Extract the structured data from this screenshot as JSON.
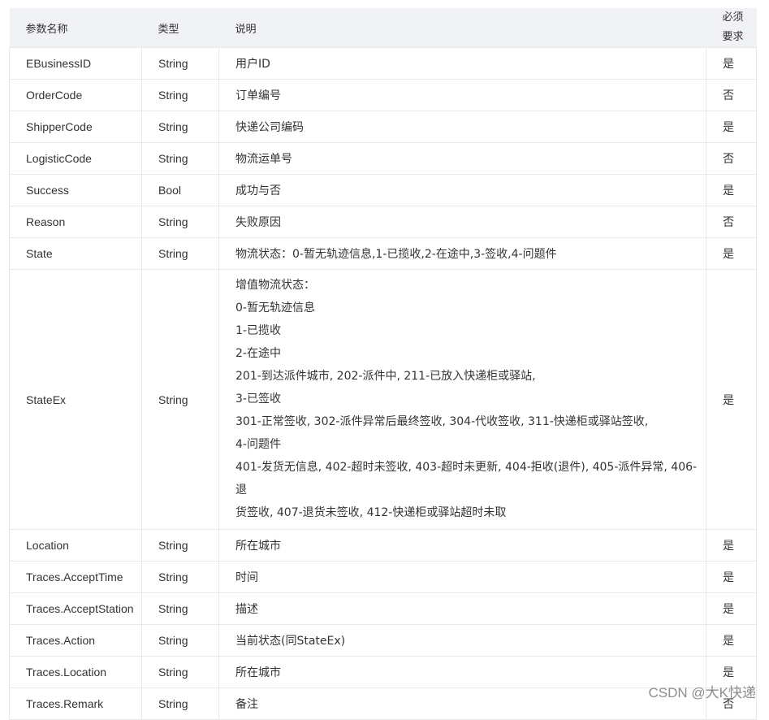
{
  "header": {
    "name": "参数名称",
    "type": "类型",
    "desc": "说明",
    "required_line1": "必须",
    "required_line2": "要求"
  },
  "rows": [
    {
      "name": "EBusinessID",
      "type": "String",
      "desc": [
        "用户ID"
      ],
      "required": "是"
    },
    {
      "name": "OrderCode",
      "type": "String",
      "desc": [
        "订单编号"
      ],
      "required": "否"
    },
    {
      "name": "ShipperCode",
      "type": "String",
      "desc": [
        "快递公司编码"
      ],
      "required": "是"
    },
    {
      "name": "LogisticCode",
      "type": "String",
      "desc": [
        "物流运单号"
      ],
      "required": "否"
    },
    {
      "name": "Success",
      "type": "Bool",
      "desc": [
        "成功与否"
      ],
      "required": "是"
    },
    {
      "name": "Reason",
      "type": "String",
      "desc": [
        "失败原因"
      ],
      "required": "否"
    },
    {
      "name": "State",
      "type": "String",
      "desc": [
        "物流状态：0-暂无轨迹信息,1-已揽收,2-在途中,3-签收,4-问题件"
      ],
      "required": "是"
    },
    {
      "name": "StateEx",
      "type": "String",
      "desc": [
        "增值物流状态：",
        "0-暂无轨迹信息",
        "1-已揽收",
        "2-在途中",
        "201-到达派件城市, 202-派件中, 211-已放入快递柜或驿站,",
        "3-已签收",
        "301-正常签收, 302-派件异常后最终签收, 304-代收签收, 311-快递柜或驿站签收,",
        "4-问题件",
        "401-发货无信息, 402-超时未签收, 403-超时未更新, 404-拒收(退件), 405-派件异常, 406-退",
        "货签收, 407-退货未签收, 412-快递柜或驿站超时未取"
      ],
      "required": "是"
    },
    {
      "name": "Location",
      "type": "String",
      "desc": [
        "所在城市"
      ],
      "required": "是"
    },
    {
      "name": "Traces.AcceptTime",
      "type": "String",
      "desc": [
        "时间"
      ],
      "required": "是"
    },
    {
      "name": "Traces.AcceptStation",
      "type": "String",
      "desc": [
        "描述"
      ],
      "required": "是"
    },
    {
      "name": "Traces.Action",
      "type": "String",
      "desc": [
        "当前状态(同StateEx)"
      ],
      "required": "是"
    },
    {
      "name": "Traces.Location",
      "type": "String",
      "desc": [
        "所在城市"
      ],
      "required": "是"
    },
    {
      "name": "Traces.Remark",
      "type": "String",
      "desc": [
        "备注"
      ],
      "required": "否"
    }
  ],
  "watermark": "CSDN @大K快递"
}
